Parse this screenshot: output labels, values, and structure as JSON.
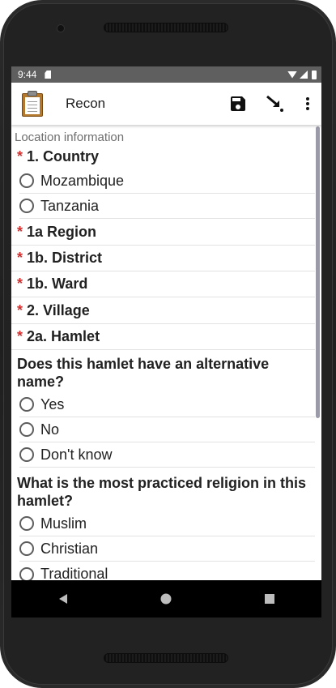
{
  "statusbar": {
    "time": "9:44"
  },
  "app": {
    "title": "Recon"
  },
  "form": {
    "section": "Location information",
    "q_country": {
      "label": "1. Country",
      "required": "*",
      "options": [
        "Mozambique",
        "Tanzania"
      ]
    },
    "q_region": {
      "label": "1a Region",
      "required": "*"
    },
    "q_district": {
      "label": "1b. District",
      "required": "*"
    },
    "q_ward": {
      "label": "1b. Ward",
      "required": "*"
    },
    "q_village": {
      "label": "2. Village",
      "required": "*"
    },
    "q_hamlet": {
      "label": "2a. Hamlet",
      "required": "*"
    },
    "q_altname": {
      "label": "Does this hamlet have an alternative name?",
      "options": [
        "Yes",
        "No",
        "Don't know"
      ]
    },
    "q_religion": {
      "label": "What is the most practiced religion in this hamlet?",
      "options": [
        "Muslim",
        "Christian",
        "Traditional"
      ]
    }
  },
  "icons": {
    "save": "save-icon",
    "jump": "go-to-prompt-icon",
    "menu": "more-vert-icon",
    "nav_back": "back-triangle-icon",
    "nav_home": "home-circle-icon",
    "nav_recent": "recents-square-icon"
  }
}
